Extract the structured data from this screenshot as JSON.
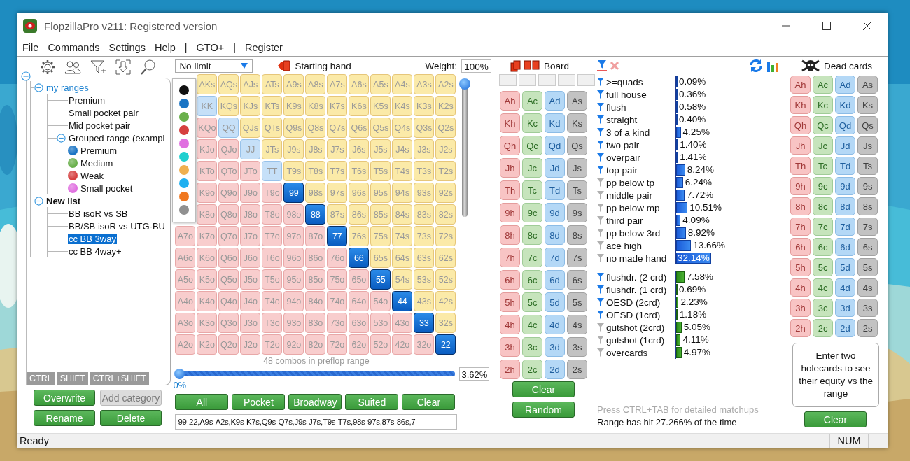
{
  "window": {
    "title": "FlopzillaPro v211: Registered version"
  },
  "menu": [
    "File",
    "Commands",
    "Settings",
    "Help",
    "|",
    "GTO+",
    "|",
    "Register"
  ],
  "ranges": {
    "tree": {
      "expanded": true,
      "children": [
        {
          "label": "my ranges",
          "kind": "list",
          "expanded": true,
          "selected": false,
          "children": [
            {
              "label": "Premium",
              "selected": false
            },
            {
              "label": "Small pocket pair",
              "selected": false
            },
            {
              "label": "Mid pocket pair",
              "selected": false
            },
            {
              "label": "Grouped range (exampl",
              "expanded": true,
              "selected": false,
              "children": [
                {
                  "label": "Premium",
                  "color": "#1a74c4",
                  "selected": false
                },
                {
                  "label": "Medium",
                  "color": "#6ab04c",
                  "selected": false
                },
                {
                  "label": "Weak",
                  "color": "#d64040",
                  "selected": false
                },
                {
                  "label": "Small pocket",
                  "color": "#e070e0",
                  "selected": false
                }
              ]
            }
          ]
        },
        {
          "label": "New list",
          "kind": "list",
          "expanded": true,
          "selected": false,
          "children": [
            {
              "label": "BB isoR vs SB",
              "selected": false
            },
            {
              "label": "BB/SB isoR vs UTG-BU",
              "selected": false
            },
            {
              "label": "cc BB 3way",
              "selected": true
            },
            {
              "label": "cc BB 4way+",
              "selected": false
            }
          ]
        }
      ]
    },
    "modifier_tabs": [
      "CTRL",
      "SHIFT",
      "CTRL+SHIFT"
    ],
    "buttons": [
      {
        "label": "Overwrite",
        "disabled": false
      },
      {
        "label": "Add category",
        "disabled": true
      },
      {
        "label": "Rename",
        "disabled": false
      },
      {
        "label": "Delete",
        "disabled": false
      }
    ]
  },
  "color_picker": [
    {
      "color": "#111111"
    },
    {
      "color": "#1a74c4"
    },
    {
      "color": "#6ab04c"
    },
    {
      "color": "#d64040"
    },
    {
      "color": "#e070e0"
    },
    {
      "color": "#20d0d0"
    },
    {
      "color": "#f0b050"
    },
    {
      "color": "#20b0f0"
    },
    {
      "color": "#f07820"
    },
    {
      "color": "#909090"
    }
  ],
  "matrix": {
    "game": "No limit",
    "title": "Starting hand",
    "weight_label": "Weight:",
    "weight": "100%",
    "rows": [
      [
        null,
        {
          "label": "AKs",
          "selected": false
        },
        {
          "label": "AQs",
          "selected": false
        },
        {
          "label": "AJs",
          "selected": false
        },
        {
          "label": "ATs",
          "selected": false
        },
        {
          "label": "A9s",
          "selected": false
        },
        {
          "label": "A8s",
          "selected": false
        },
        {
          "label": "A7s",
          "selected": false
        },
        {
          "label": "A6s",
          "selected": false
        },
        {
          "label": "A5s",
          "selected": false
        },
        {
          "label": "A4s",
          "selected": false
        },
        {
          "label": "A3s",
          "selected": false
        },
        {
          "label": "A2s",
          "selected": false
        }
      ],
      [
        null,
        {
          "label": "KK",
          "selected": false
        },
        {
          "label": "KQs",
          "selected": false
        },
        {
          "label": "KJs",
          "selected": false
        },
        {
          "label": "KTs",
          "selected": false
        },
        {
          "label": "K9s",
          "selected": false
        },
        {
          "label": "K8s",
          "selected": false
        },
        {
          "label": "K7s",
          "selected": false
        },
        {
          "label": "K6s",
          "selected": false
        },
        {
          "label": "K5s",
          "selected": false
        },
        {
          "label": "K4s",
          "selected": false
        },
        {
          "label": "K3s",
          "selected": false
        },
        {
          "label": "K2s",
          "selected": false
        }
      ],
      [
        null,
        {
          "label": "KQo",
          "selected": false
        },
        {
          "label": "QQ",
          "selected": false
        },
        {
          "label": "QJs",
          "selected": false
        },
        {
          "label": "QTs",
          "selected": false
        },
        {
          "label": "Q9s",
          "selected": false
        },
        {
          "label": "Q8s",
          "selected": false
        },
        {
          "label": "Q7s",
          "selected": false
        },
        {
          "label": "Q6s",
          "selected": false
        },
        {
          "label": "Q5s",
          "selected": false
        },
        {
          "label": "Q4s",
          "selected": false
        },
        {
          "label": "Q3s",
          "selected": false
        },
        {
          "label": "Q2s",
          "selected": false
        }
      ],
      [
        null,
        {
          "label": "KJo",
          "selected": false
        },
        {
          "label": "QJo",
          "selected": false
        },
        {
          "label": "JJ",
          "selected": false
        },
        {
          "label": "JTs",
          "selected": false
        },
        {
          "label": "J9s",
          "selected": false
        },
        {
          "label": "J8s",
          "selected": false
        },
        {
          "label": "J7s",
          "selected": false
        },
        {
          "label": "J6s",
          "selected": false
        },
        {
          "label": "J5s",
          "selected": false
        },
        {
          "label": "J4s",
          "selected": false
        },
        {
          "label": "J3s",
          "selected": false
        },
        {
          "label": "J2s",
          "selected": false
        }
      ],
      [
        null,
        {
          "label": "KTo",
          "selected": false
        },
        {
          "label": "QTo",
          "selected": false
        },
        {
          "label": "JTo",
          "selected": false
        },
        {
          "label": "TT",
          "selected": false
        },
        {
          "label": "T9s",
          "selected": false
        },
        {
          "label": "T8s",
          "selected": false
        },
        {
          "label": "T7s",
          "selected": false
        },
        {
          "label": "T6s",
          "selected": false
        },
        {
          "label": "T5s",
          "selected": false
        },
        {
          "label": "T4s",
          "selected": false
        },
        {
          "label": "T3s",
          "selected": false
        },
        {
          "label": "T2s",
          "selected": false
        }
      ],
      [
        null,
        {
          "label": "K9o",
          "selected": false
        },
        {
          "label": "Q9o",
          "selected": false
        },
        {
          "label": "J9o",
          "selected": false
        },
        {
          "label": "T9o",
          "selected": false
        },
        {
          "label": "99",
          "selected": true
        },
        {
          "label": "98s",
          "selected": false
        },
        {
          "label": "97s",
          "selected": false
        },
        {
          "label": "96s",
          "selected": false
        },
        {
          "label": "95s",
          "selected": false
        },
        {
          "label": "94s",
          "selected": false
        },
        {
          "label": "93s",
          "selected": false
        },
        {
          "label": "92s",
          "selected": false
        }
      ],
      [
        null,
        {
          "label": "K8o",
          "selected": false
        },
        {
          "label": "Q8o",
          "selected": false
        },
        {
          "label": "J8o",
          "selected": false
        },
        {
          "label": "T8o",
          "selected": false
        },
        {
          "label": "98o",
          "selected": false
        },
        {
          "label": "88",
          "selected": true
        },
        {
          "label": "87s",
          "selected": false
        },
        {
          "label": "86s",
          "selected": false
        },
        {
          "label": "85s",
          "selected": false
        },
        {
          "label": "84s",
          "selected": false
        },
        {
          "label": "83s",
          "selected": false
        },
        {
          "label": "82s",
          "selected": false
        }
      ],
      [
        {
          "label": "A7o",
          "selected": false
        },
        {
          "label": "K7o",
          "selected": false
        },
        {
          "label": "Q7o",
          "selected": false
        },
        {
          "label": "J7o",
          "selected": false
        },
        {
          "label": "T7o",
          "selected": false
        },
        {
          "label": "97o",
          "selected": false
        },
        {
          "label": "87o",
          "selected": false
        },
        {
          "label": "77",
          "selected": true
        },
        {
          "label": "76s",
          "selected": false
        },
        {
          "label": "75s",
          "selected": false
        },
        {
          "label": "74s",
          "selected": false
        },
        {
          "label": "73s",
          "selected": false
        },
        {
          "label": "72s",
          "selected": false
        }
      ],
      [
        {
          "label": "A6o",
          "selected": false
        },
        {
          "label": "K6o",
          "selected": false
        },
        {
          "label": "Q6o",
          "selected": false
        },
        {
          "label": "J6o",
          "selected": false
        },
        {
          "label": "T6o",
          "selected": false
        },
        {
          "label": "96o",
          "selected": false
        },
        {
          "label": "86o",
          "selected": false
        },
        {
          "label": "76o",
          "selected": false
        },
        {
          "label": "66",
          "selected": true
        },
        {
          "label": "65s",
          "selected": false
        },
        {
          "label": "64s",
          "selected": false
        },
        {
          "label": "63s",
          "selected": false
        },
        {
          "label": "62s",
          "selected": false
        }
      ],
      [
        {
          "label": "A5o",
          "selected": false
        },
        {
          "label": "K5o",
          "selected": false
        },
        {
          "label": "Q5o",
          "selected": false
        },
        {
          "label": "J5o",
          "selected": false
        },
        {
          "label": "T5o",
          "selected": false
        },
        {
          "label": "95o",
          "selected": false
        },
        {
          "label": "85o",
          "selected": false
        },
        {
          "label": "75o",
          "selected": false
        },
        {
          "label": "65o",
          "selected": false
        },
        {
          "label": "55",
          "selected": true
        },
        {
          "label": "54s",
          "selected": false
        },
        {
          "label": "53s",
          "selected": false
        },
        {
          "label": "52s",
          "selected": false
        }
      ],
      [
        {
          "label": "A4o",
          "selected": false
        },
        {
          "label": "K4o",
          "selected": false
        },
        {
          "label": "Q4o",
          "selected": false
        },
        {
          "label": "J4o",
          "selected": false
        },
        {
          "label": "T4o",
          "selected": false
        },
        {
          "label": "94o",
          "selected": false
        },
        {
          "label": "84o",
          "selected": false
        },
        {
          "label": "74o",
          "selected": false
        },
        {
          "label": "64o",
          "selected": false
        },
        {
          "label": "54o",
          "selected": false
        },
        {
          "label": "44",
          "selected": true
        },
        {
          "label": "43s",
          "selected": false
        },
        {
          "label": "42s",
          "selected": false
        }
      ],
      [
        {
          "label": "A3o",
          "selected": false
        },
        {
          "label": "K3o",
          "selected": false
        },
        {
          "label": "Q3o",
          "selected": false
        },
        {
          "label": "J3o",
          "selected": false
        },
        {
          "label": "T3o",
          "selected": false
        },
        {
          "label": "93o",
          "selected": false
        },
        {
          "label": "83o",
          "selected": false
        },
        {
          "label": "73o",
          "selected": false
        },
        {
          "label": "63o",
          "selected": false
        },
        {
          "label": "53o",
          "selected": false
        },
        {
          "label": "43o",
          "selected": false
        },
        {
          "label": "33",
          "selected": true
        },
        {
          "label": "32s",
          "selected": false
        }
      ],
      [
        {
          "label": "A2o",
          "selected": false
        },
        {
          "label": "K2o",
          "selected": false
        },
        {
          "label": "Q2o",
          "selected": false
        },
        {
          "label": "J2o",
          "selected": false
        },
        {
          "label": "T2o",
          "selected": false
        },
        {
          "label": "92o",
          "selected": false
        },
        {
          "label": "82o",
          "selected": false
        },
        {
          "label": "72o",
          "selected": false
        },
        {
          "label": "62o",
          "selected": false
        },
        {
          "label": "52o",
          "selected": false
        },
        {
          "label": "42o",
          "selected": false
        },
        {
          "label": "32o",
          "selected": false
        },
        {
          "label": "22",
          "selected": true
        }
      ]
    ],
    "weight_slider": {
      "level": 1
    },
    "combos": "48 combos in preflop range",
    "range_slider": {
      "level": 0
    },
    "range_percent": "3.62%",
    "slider_min": "0%",
    "buttons": [
      "All",
      "Pocket",
      "Broadway",
      "Suited",
      "Clear"
    ],
    "range_text": "99-22,A9s-A2s,K9s-K7s,Q9s-Q7s,J9s-J7s,T9s-T7s,98s-97s,87s-86s,7"
  },
  "board": {
    "title": "Board",
    "cards": [
      [
        "Ah",
        "Ac",
        "Ad",
        "As"
      ],
      [
        "Kh",
        "Kc",
        "Kd",
        "Ks"
      ],
      [
        "Qh",
        "Qc",
        "Qd",
        "Qs"
      ],
      [
        "Jh",
        "Jc",
        "Jd",
        "Js"
      ],
      [
        "Th",
        "Tc",
        "Td",
        "Ts"
      ],
      [
        "9h",
        "9c",
        "9d",
        "9s"
      ],
      [
        "8h",
        "8c",
        "8d",
        "8s"
      ],
      [
        "7h",
        "7c",
        "7d",
        "7s"
      ],
      [
        "6h",
        "6c",
        "6d",
        "6s"
      ],
      [
        "5h",
        "5c",
        "5d",
        "5s"
      ],
      [
        "4h",
        "4c",
        "4d",
        "4s"
      ],
      [
        "3h",
        "3c",
        "3d",
        "3s"
      ],
      [
        "2h",
        "2c",
        "2d",
        "2s"
      ]
    ],
    "buttons": [
      "Clear",
      "Random"
    ]
  },
  "stats": {
    "made_hands": [
      {
        "label": ">=quads",
        "filtered": true,
        "level": 0.0009,
        "reading": "0.09%",
        "selected": false
      },
      {
        "label": "full house",
        "filtered": true,
        "level": 0.0036,
        "reading": "0.36%",
        "selected": false
      },
      {
        "label": "flush",
        "filtered": true,
        "level": 0.0058,
        "reading": "0.58%",
        "selected": false
      },
      {
        "label": "straight",
        "filtered": true,
        "level": 0.004,
        "reading": "0.40%",
        "selected": false
      },
      {
        "label": "3 of a kind",
        "filtered": true,
        "level": 0.0425,
        "reading": "4.25%",
        "selected": false
      },
      {
        "label": "two pair",
        "filtered": true,
        "level": 0.014,
        "reading": "1.40%",
        "selected": false
      },
      {
        "label": "overpair",
        "filtered": true,
        "level": 0.0141,
        "reading": "1.41%",
        "selected": false
      },
      {
        "label": "top pair",
        "filtered": true,
        "level": 0.0824,
        "reading": "8.24%",
        "selected": false
      },
      {
        "label": "pp below tp",
        "filtered": false,
        "level": 0.0624,
        "reading": "6.24%",
        "selected": false
      },
      {
        "label": "middle pair",
        "filtered": false,
        "level": 0.0772,
        "reading": "7.72%",
        "selected": false
      },
      {
        "label": "pp below mp",
        "filtered": false,
        "level": 0.1051,
        "reading": "10.51%",
        "selected": false
      },
      {
        "label": "third pair",
        "filtered": false,
        "level": 0.0409,
        "reading": "4.09%",
        "selected": false
      },
      {
        "label": "pp below 3rd",
        "filtered": false,
        "level": 0.0892,
        "reading": "8.92%",
        "selected": false
      },
      {
        "label": "ace high",
        "filtered": false,
        "level": 0.1366,
        "reading": "13.66%",
        "selected": false
      },
      {
        "label": "no made hand",
        "filtered": false,
        "level": 0.3214,
        "reading": "32.14%",
        "selected": true
      }
    ],
    "draws": [
      {
        "label": "flushdr. (2 crd)",
        "filtered": true,
        "level": 0.0758,
        "reading": "7.58%",
        "selected": false
      },
      {
        "label": "flushdr. (1 crd)",
        "filtered": true,
        "level": 0.0069,
        "reading": "0.69%",
        "selected": false
      },
      {
        "label": "OESD (2crd)",
        "filtered": true,
        "level": 0.0223,
        "reading": "2.23%",
        "selected": false
      },
      {
        "label": "OESD (1crd)",
        "filtered": true,
        "level": 0.0118,
        "reading": "1.18%",
        "selected": false
      },
      {
        "label": "gutshot (2crd)",
        "filtered": false,
        "level": 0.0505,
        "reading": "5.05%",
        "selected": false
      },
      {
        "label": "gutshot (1crd)",
        "filtered": false,
        "level": 0.0411,
        "reading": "4.11%",
        "selected": false
      },
      {
        "label": "overcards",
        "filtered": false,
        "level": 0.0497,
        "reading": "4.97%",
        "selected": false
      }
    ],
    "hint": "Press CTRL+TAB for detailed matchups",
    "summary": "Range has hit 27.266% of the time"
  },
  "dead_cards": {
    "title": "Dead cards",
    "cards": [
      [
        "Ah",
        "Ac",
        "Ad",
        "As"
      ],
      [
        "Kh",
        "Kc",
        "Kd",
        "Ks"
      ],
      [
        "Qh",
        "Qc",
        "Qd",
        "Qs"
      ],
      [
        "Jh",
        "Jc",
        "Jd",
        "Js"
      ],
      [
        "Th",
        "Tc",
        "Td",
        "Ts"
      ],
      [
        "9h",
        "9c",
        "9d",
        "9s"
      ],
      [
        "8h",
        "8c",
        "8d",
        "8s"
      ],
      [
        "7h",
        "7c",
        "7d",
        "7s"
      ],
      [
        "6h",
        "6c",
        "6d",
        "6s"
      ],
      [
        "5h",
        "5c",
        "5d",
        "5s"
      ],
      [
        "4h",
        "4c",
        "4d",
        "4s"
      ],
      [
        "3h",
        "3c",
        "3d",
        "3s"
      ],
      [
        "2h",
        "2c",
        "2d",
        "2s"
      ]
    ],
    "equity_hint": "Enter two holecards to see their equity vs the range",
    "button": "Clear"
  },
  "status_bar": {
    "message": "Ready",
    "indicator": "NUM"
  }
}
